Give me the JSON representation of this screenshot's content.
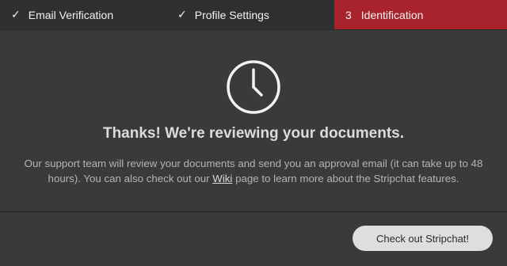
{
  "steps": [
    {
      "label": "Email Verification",
      "icon": "check-icon",
      "status": "complete"
    },
    {
      "label": "Profile Settings",
      "icon": "check-icon",
      "status": "complete"
    },
    {
      "number": "3",
      "label": "Identification",
      "status": "active"
    }
  ],
  "main": {
    "icon": "clock-icon",
    "title": "Thanks! We're reviewing your documents.",
    "message_part1": "Our support team will review your documents and send you an approval email (it can take up to 48 hours). You can also check out our ",
    "wiki_link": "Wiki",
    "message_part2": " page to learn more about the Stripchat features."
  },
  "footer": {
    "cta_label": "Check out Stripchat!"
  },
  "colors": {
    "background": "#3a3a3a",
    "stepbar": "#2f3032",
    "active_step": "#a8232b",
    "button": "#dedede"
  }
}
